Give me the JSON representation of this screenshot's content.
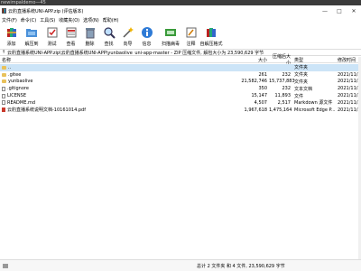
{
  "top_strip": "newimpaldemo—45",
  "window": {
    "title": "云豹直播系统UNI-APP.zip (评估版本)",
    "controls": [
      "—",
      "□",
      "✕"
    ]
  },
  "menu": [
    "文件(F)",
    "命令(C)",
    "工具(S)",
    "收藏夹(O)",
    "选项(N)",
    "帮助(H)"
  ],
  "toolbar": [
    {
      "label": "添加",
      "icon": "add-archive-icon"
    },
    {
      "label": "解压到",
      "icon": "extract-to-icon"
    },
    {
      "label": "测试",
      "icon": "test-icon"
    },
    {
      "label": "查看",
      "icon": "view-icon"
    },
    {
      "label": "删除",
      "icon": "delete-icon"
    },
    {
      "label": "查找",
      "icon": "find-icon"
    },
    {
      "label": "向导",
      "icon": "wizard-icon"
    },
    {
      "label": "信息",
      "icon": "info-icon"
    },
    {
      "label": "扫描病毒",
      "icon": "virus-scan-icon"
    },
    {
      "label": "注释",
      "icon": "comment-icon"
    },
    {
      "label": "自解压格式",
      "icon": "sfx-icon"
    }
  ],
  "address": "云豹直播系统UNI-APP.zip\\云豹直播系统UNI-APP\\yunbaolive_uni-app-master - ZIP 压缩文件, 解包大小为 23,590,629 字节",
  "columns": {
    "name": "名称",
    "size": "大小",
    "packed": "压缩后大小",
    "type": "类型",
    "modified": "修改时间"
  },
  "files": [
    {
      "name": "..",
      "size": "",
      "packed": "",
      "type": "文件夹",
      "modified": "",
      "kind": "folder"
    },
    {
      "name": ".gitee",
      "size": "261",
      "packed": "232",
      "type": "文件夹",
      "modified": "2021/11/2",
      "kind": "folder"
    },
    {
      "name": "yunbaolive",
      "size": "21,582,746",
      "packed": "15,737,883",
      "type": "文件夹",
      "modified": "2021/11/2",
      "kind": "folder"
    },
    {
      "name": ".gitignore",
      "size": "350",
      "packed": "232",
      "type": "文本文档",
      "modified": "2021/11/2",
      "kind": "file"
    },
    {
      "name": "LICENSE",
      "size": "15,147",
      "packed": "11,893",
      "type": "文件",
      "modified": "2021/11/2",
      "kind": "file"
    },
    {
      "name": "README.md",
      "size": "4,507",
      "packed": "2,517",
      "type": "Markdown 源文件",
      "modified": "2021/11/2",
      "kind": "file"
    },
    {
      "name": "云豹直播系统说明文档-10161014.pdf",
      "size": "1,967,618",
      "packed": "1,475,164",
      "type": "Microsoft Edge P...",
      "modified": "2021/11/2",
      "kind": "pdf"
    }
  ],
  "status": "总计 2 文件夹 和 4 文件, 23,590,629 字节"
}
